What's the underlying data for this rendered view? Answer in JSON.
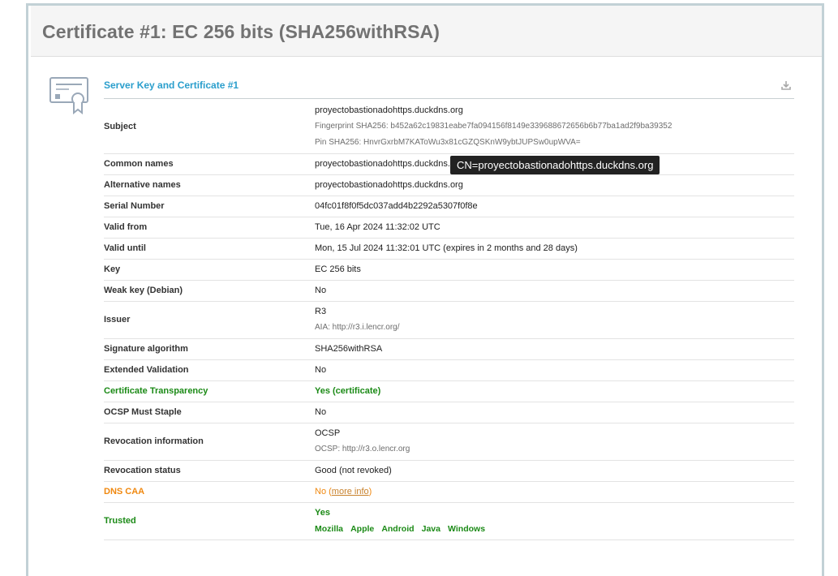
{
  "title": "Certificate #1: EC 256 bits (SHA256withRSA)",
  "section": {
    "label": "Server Key and Certificate #1",
    "download_icon": "download-icon",
    "cert_icon": "certificate-icon"
  },
  "colors": {
    "title": "#727272",
    "section_label": "#2a9ecc",
    "good": "#1b8a16",
    "warn": "#f0880f",
    "frame_border": "#c2d1d6"
  },
  "rows": {
    "subject": {
      "key": "Subject",
      "value": "proyectobastionadohttps.duckdns.org",
      "fingerprint": "Fingerprint SHA256: b452a62c19831eabe7fa094156f8149e339688672656b6b77ba1ad2f9ba39352",
      "pin": "Pin SHA256: HnvrGxrbM7KAToWu3x81cGZQSKnW9ybtJUPSw0upWVA="
    },
    "common_names": {
      "key": "Common names",
      "value": "proyectobastionadohttps.duckdns.org"
    },
    "alt_names": {
      "key": "Alternative names",
      "value": "proyectobastionadohttps.duckdns.org"
    },
    "serial": {
      "key": "Serial Number",
      "value": "04fc01f8f0f5dc037add4b2292a5307f0f8e"
    },
    "valid_from": {
      "key": "Valid from",
      "value": "Tue, 16 Apr 2024 11:32:02 UTC"
    },
    "valid_until": {
      "key": "Valid until",
      "value": "Mon, 15 Jul 2024 11:32:01 UTC (expires in 2 months and 28 days)"
    },
    "key": {
      "key": "Key",
      "value": "EC 256 bits"
    },
    "weak_key": {
      "key": "Weak key (Debian)",
      "value": "No"
    },
    "issuer": {
      "key": "Issuer",
      "value": "R3",
      "aia": "AIA: http://r3.i.lencr.org/"
    },
    "sig_alg": {
      "key": "Signature algorithm",
      "value": "SHA256withRSA"
    },
    "ev": {
      "key": "Extended Validation",
      "value": "No"
    },
    "ct": {
      "key": "Certificate Transparency",
      "value": "Yes (certificate)"
    },
    "ocsp_staple": {
      "key": "OCSP Must Staple",
      "value": "No"
    },
    "revocation_info": {
      "key": "Revocation information",
      "value": "OCSP",
      "ocsp": "OCSP: http://r3.o.lencr.org"
    },
    "revocation_status": {
      "key": "Revocation status",
      "value": "Good (not revoked)"
    },
    "dns_caa": {
      "key": "DNS CAA",
      "value": "No",
      "paren_open": "(",
      "link": "more info",
      "paren_close": ")"
    },
    "trusted": {
      "key": "Trusted",
      "value": "Yes",
      "stores": [
        "Mozilla",
        "Apple",
        "Android",
        "Java",
        "Windows"
      ]
    }
  },
  "tooltip": "CN=proyectobastionadohttps.duckdns.org"
}
